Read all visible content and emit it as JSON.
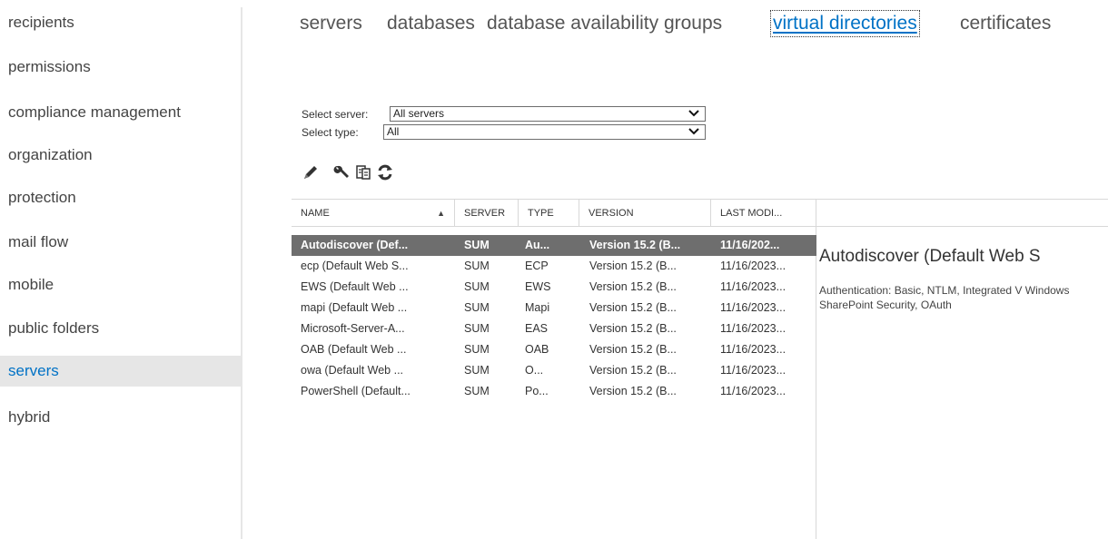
{
  "sidebar": {
    "items": [
      {
        "label": "recipients"
      },
      {
        "label": "permissions"
      },
      {
        "label": "compliance management"
      },
      {
        "label": "organization"
      },
      {
        "label": "protection"
      },
      {
        "label": "mail flow"
      },
      {
        "label": "mobile"
      },
      {
        "label": "public folders"
      },
      {
        "label": "servers",
        "selected": true
      },
      {
        "label": "hybrid"
      }
    ]
  },
  "tabs": [
    {
      "label": "servers"
    },
    {
      "label": "databases"
    },
    {
      "label": "database availability groups"
    },
    {
      "label": "virtual directories",
      "active": true
    },
    {
      "label": "certificates"
    }
  ],
  "filters": {
    "server": {
      "label": "Select server:",
      "value": "All servers"
    },
    "type": {
      "label": "Select type:",
      "value": "All"
    }
  },
  "toolbar": {
    "icons": [
      "edit-pencil-icon",
      "configure-wrench-icon",
      "reset-document-icon",
      "refresh-icon"
    ]
  },
  "table": {
    "columns": [
      "NAME",
      "SERVER",
      "TYPE",
      "VERSION",
      "LAST MODI..."
    ],
    "sort": {
      "column": "NAME",
      "direction": "ascending"
    },
    "rows": [
      [
        "Autodiscover (Def...",
        "SUM",
        "Au...",
        "Version 15.2 (B...",
        "11/16/202..."
      ],
      [
        "ecp (Default Web S...",
        "SUM",
        "ECP",
        "Version 15.2 (B...",
        "11/16/2023..."
      ],
      [
        "EWS (Default Web ...",
        "SUM",
        "EWS",
        "Version 15.2 (B...",
        "11/16/2023..."
      ],
      [
        "mapi (Default Web ...",
        "SUM",
        "Mapi",
        "Version 15.2 (B...",
        "11/16/2023..."
      ],
      [
        "Microsoft-Server-A...",
        "SUM",
        "EAS",
        "Version 15.2 (B...",
        "11/16/2023..."
      ],
      [
        "OAB (Default Web ...",
        "SUM",
        "OAB",
        "Version 15.2 (B...",
        "11/16/2023..."
      ],
      [
        "owa (Default Web ...",
        "SUM",
        "O...",
        "Version 15.2 (B...",
        "11/16/2023..."
      ],
      [
        "PowerShell (Default...",
        "SUM",
        "Po...",
        "Version 15.2 (B...",
        "11/16/2023..."
      ]
    ],
    "selected_row": 0
  },
  "details": {
    "title": "Autodiscover (Default Web S",
    "info": "Authentication: Basic, NTLM, Integrated V Windows SharePoint Security, OAuth"
  },
  "colors": {
    "accent": "#0072c6",
    "selected_row_bg": "#6e6e6e",
    "selected_nav_bg": "#e6e6e6"
  }
}
